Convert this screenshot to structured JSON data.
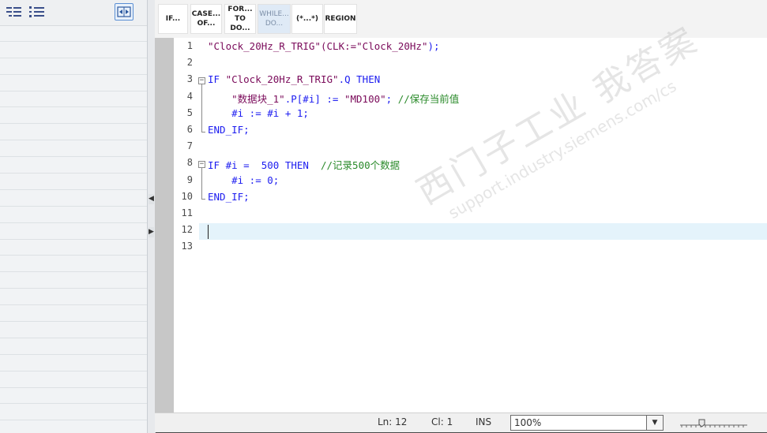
{
  "left_panel": {
    "row_count": 24
  },
  "snippets": [
    {
      "line1": "IF...",
      "line2": "",
      "active": false
    },
    {
      "line1": "CASE...",
      "line2": "OF...",
      "active": false
    },
    {
      "line1": "FOR...",
      "line2": "TO DO...",
      "active": false
    },
    {
      "line1": "WHILE...",
      "line2": "DO...",
      "active": true
    },
    {
      "line1": "(*...*)",
      "line2": "",
      "active": false
    },
    {
      "line1": "REGION",
      "line2": "",
      "active": false
    }
  ],
  "code": {
    "line_numbers": [
      "1",
      "2",
      "3",
      "4",
      "5",
      "6",
      "7",
      "8",
      "9",
      "10",
      "11",
      "12",
      "13"
    ],
    "lines": [
      [
        {
          "t": "\"Clock_20Hz_R_TRIG\"",
          "c": "str"
        },
        {
          "t": "(CLK:=",
          "c": "str"
        },
        {
          "t": "\"Clock_20Hz\"",
          "c": "str"
        },
        {
          "t": ");",
          "c": "plain"
        }
      ],
      [],
      [
        {
          "t": "IF ",
          "c": "kw"
        },
        {
          "t": "\"Clock_20Hz_R_TRIG\"",
          "c": "str"
        },
        {
          "t": ".Q ",
          "c": "plain"
        },
        {
          "t": "THEN",
          "c": "kw"
        }
      ],
      [
        {
          "t": "    ",
          "c": "plain"
        },
        {
          "t": "\"数据块_1\"",
          "c": "str"
        },
        {
          "t": ".P[#i] := ",
          "c": "plain"
        },
        {
          "t": "\"MD100\"",
          "c": "str"
        },
        {
          "t": "; ",
          "c": "plain"
        },
        {
          "t": "//保存当前值",
          "c": "cmt"
        }
      ],
      [
        {
          "t": "    #i := #i + 1;",
          "c": "plain"
        }
      ],
      [
        {
          "t": "END_IF;",
          "c": "kw"
        }
      ],
      [],
      [
        {
          "t": "IF ",
          "c": "kw"
        },
        {
          "t": "#i =  500 ",
          "c": "plain"
        },
        {
          "t": "THEN",
          "c": "kw"
        },
        {
          "t": "  //记录500个数据",
          "c": "cmt"
        }
      ],
      [
        {
          "t": "    #i := 0;",
          "c": "plain"
        }
      ],
      [
        {
          "t": "END_IF;",
          "c": "kw"
        }
      ],
      [],
      [],
      []
    ]
  },
  "watermark": {
    "line1": "西门子工业  我答案",
    "line2": "support.industry.siemens.com/cs"
  },
  "status": {
    "ln": "Ln: 12",
    "cl": "Cl: 1",
    "mode": "INS",
    "zoom": "100%"
  },
  "colors": {
    "gutter": "#c7c7c7",
    "current_line": "#e4f3fb",
    "keyword": "#1d1df0",
    "string": "#7a0a5a",
    "comment": "#2a8a2a"
  }
}
